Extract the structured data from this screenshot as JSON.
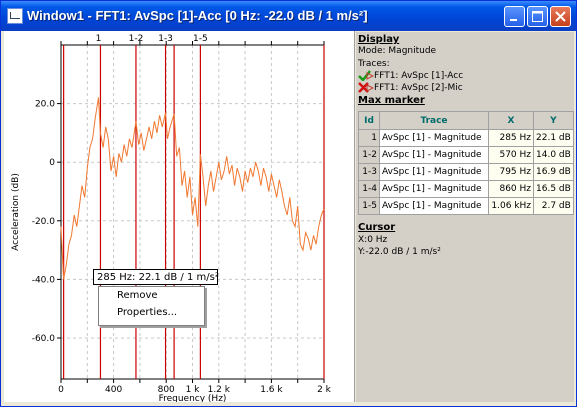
{
  "window": {
    "title": "Window1 - FFT1: AvSpc [1]-Acc [0 Hz: -22.0 dB / 1 m/s²]"
  },
  "chart_data": {
    "type": "line",
    "xlabel": "Frequency (Hz)",
    "ylabel": "Acceleration (dB)",
    "xlim": [
      0,
      2000
    ],
    "ylim": [
      -74,
      40
    ],
    "grid": true,
    "x_ticks": [
      0,
      200,
      400,
      600,
      800,
      1000,
      1200,
      1400,
      1600,
      1800,
      2000
    ],
    "x_tick_labels": [
      "0",
      "",
      "400",
      "",
      "800",
      "1 k",
      "1.2 k",
      "",
      "1.6 k",
      "",
      "2 k"
    ],
    "y_ticks": [
      20,
      0,
      -20,
      -40,
      -60
    ],
    "y_tick_labels": [
      "20.0",
      "0",
      "-20.0",
      "-40.0",
      "-60.0"
    ],
    "marker_lines": [
      20,
      300,
      570,
      795,
      860,
      1060,
      2000
    ],
    "marker_labels": [
      {
        "label": "1",
        "x": 285
      },
      {
        "label": "1-2",
        "x": 570
      },
      {
        "label": "1-3",
        "x": 795
      },
      {
        "label": "1-5",
        "x": 1060
      }
    ],
    "series": [
      {
        "color": "#f07830",
        "x": [
          0,
          20,
          40,
          60,
          80,
          100,
          120,
          140,
          160,
          180,
          200,
          220,
          240,
          260,
          285,
          300,
          320,
          340,
          360,
          380,
          400,
          420,
          440,
          460,
          480,
          500,
          520,
          540,
          570,
          590,
          610,
          630,
          650,
          670,
          690,
          710,
          730,
          750,
          770,
          795,
          810,
          830,
          860,
          880,
          900,
          920,
          940,
          960,
          980,
          1000,
          1020,
          1040,
          1060,
          1080,
          1100,
          1120,
          1140,
          1160,
          1180,
          1200,
          1220,
          1240,
          1260,
          1280,
          1300,
          1320,
          1340,
          1360,
          1380,
          1400,
          1420,
          1440,
          1460,
          1480,
          1500,
          1520,
          1540,
          1560,
          1580,
          1600,
          1620,
          1640,
          1660,
          1680,
          1700,
          1720,
          1740,
          1760,
          1780,
          1800,
          1820,
          1840,
          1860,
          1880,
          1900,
          1920,
          1940,
          1960,
          1980,
          2000
        ],
        "y": [
          -22,
          -40,
          -35,
          -28,
          -25,
          -18,
          -22,
          -15,
          -8,
          -12,
          -2,
          5,
          8,
          15,
          22.1,
          10,
          5,
          12,
          8,
          -3,
          2,
          -5,
          3,
          0,
          6,
          2,
          8,
          5,
          14,
          6,
          10,
          4,
          8,
          12,
          8,
          14,
          10,
          16,
          12,
          16.9,
          8,
          12,
          16.5,
          2,
          5,
          -8,
          -3,
          -12,
          -5,
          -18,
          -12,
          -22,
          2.7,
          -5,
          -15,
          -8,
          -3,
          -10,
          -5,
          0,
          -6,
          -3,
          2,
          -4,
          -1,
          -8,
          -2,
          -5,
          -10,
          -3,
          -7,
          -2,
          -5,
          0,
          -3,
          -8,
          -2,
          -5,
          -10,
          -4,
          -8,
          -12,
          -6,
          -10,
          -15,
          -18,
          -12,
          -20,
          -22,
          -15,
          -28,
          -30,
          -24,
          -26,
          -30,
          -25,
          -28,
          -22,
          -18,
          -16
        ]
      }
    ]
  },
  "tooltip": {
    "text": "285 Hz: 22.1 dB / 1 m/s²"
  },
  "context_menu": {
    "items": [
      "Remove",
      "Properties..."
    ]
  },
  "display": {
    "heading": "Display",
    "mode": "Mode: Magnitude",
    "traces_label": "Traces:",
    "traces": [
      "FFT1: AvSpc [1]-Acc",
      "FFT1: AvSpc [2]-Mic"
    ]
  },
  "max_marker": {
    "heading": "Max marker",
    "columns": [
      "Id",
      "Trace",
      "X",
      "Y"
    ],
    "rows": [
      {
        "id": "1",
        "trace": "AvSpc [1] - Magnitude",
        "x": "285 Hz",
        "y": "22.1 dB"
      },
      {
        "id": "1-2",
        "trace": "AvSpc [1] - Magnitude",
        "x": "570 Hz",
        "y": "14.0 dB"
      },
      {
        "id": "1-3",
        "trace": "AvSpc [1] - Magnitude",
        "x": "795 Hz",
        "y": "16.9 dB"
      },
      {
        "id": "1-4",
        "trace": "AvSpc [1] - Magnitude",
        "x": "860 Hz",
        "y": "16.5 dB"
      },
      {
        "id": "1-5",
        "trace": "AvSpc [1] - Magnitude",
        "x": "1.06 kHz",
        "y": "2.7 dB"
      }
    ]
  },
  "cursor": {
    "heading": "Cursor",
    "x": "X:0 Hz",
    "y": "Y:-22.0 dB / 1 m/s²"
  }
}
